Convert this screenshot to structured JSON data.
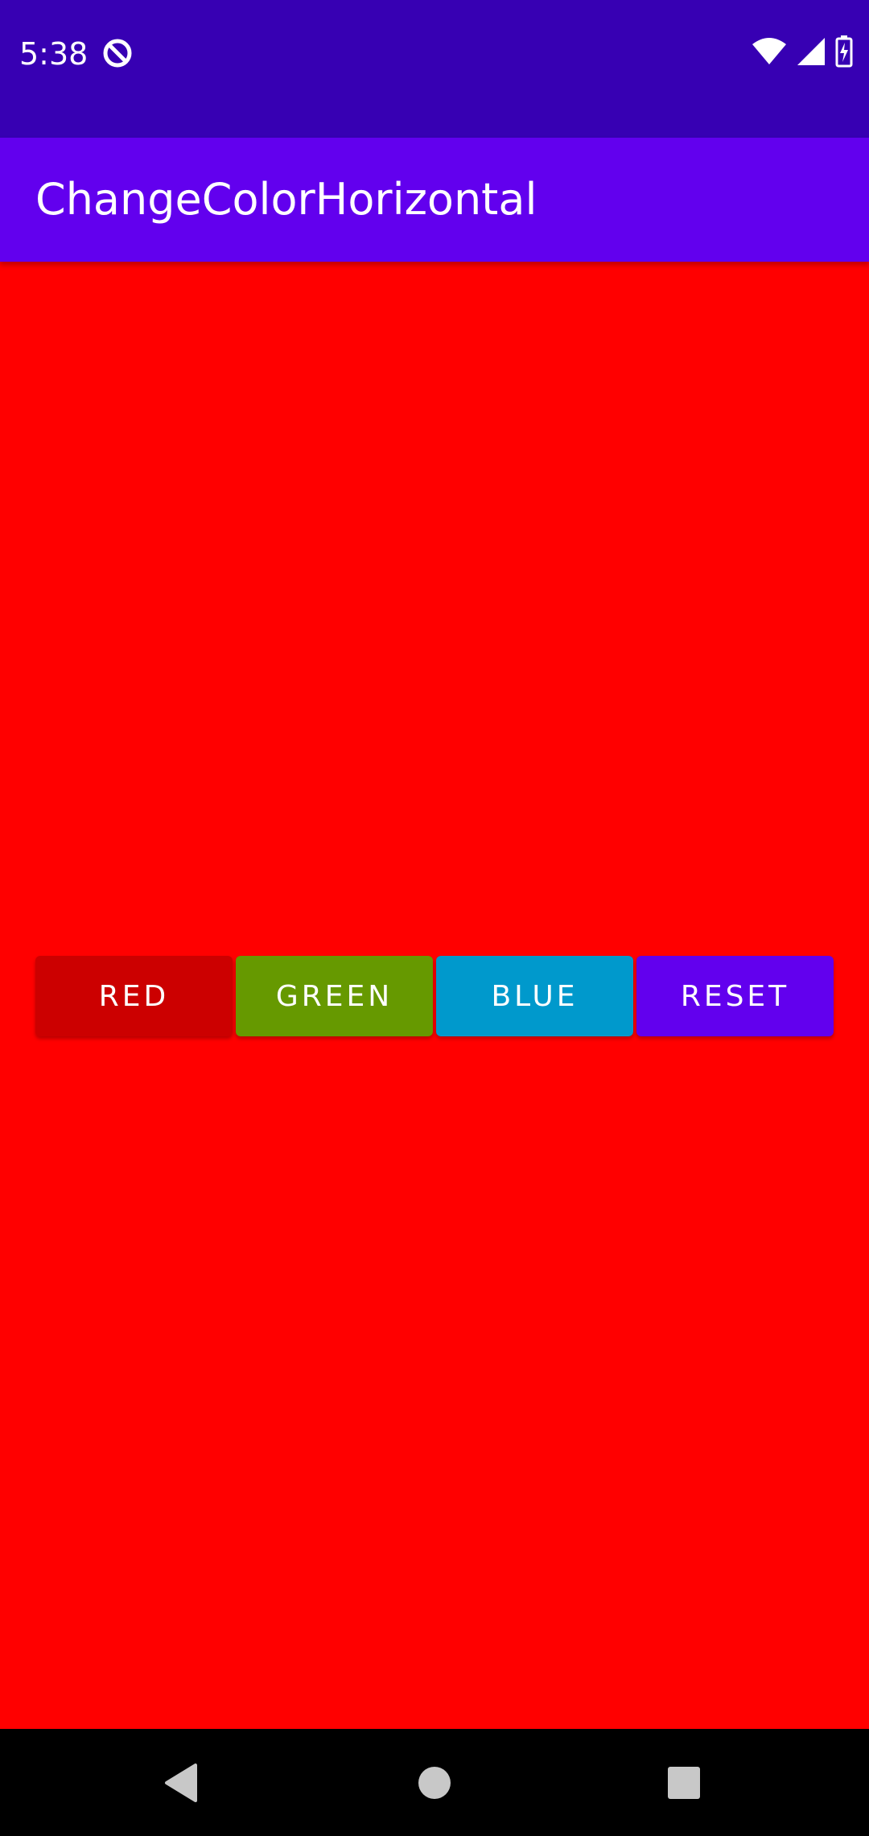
{
  "status_bar": {
    "time": "5:38",
    "app_icon": "no-disturb-icon",
    "icons": [
      "wifi-icon",
      "cell-signal-icon",
      "battery-charging-icon"
    ]
  },
  "app_bar": {
    "title": "ChangeColorHorizontal",
    "color": "#6200ee"
  },
  "content": {
    "background_color": "#ff0000"
  },
  "buttons": [
    {
      "label": "RED",
      "color": "#cc0000"
    },
    {
      "label": "GREEN",
      "color": "#669900"
    },
    {
      "label": "BLUE",
      "color": "#0099cc"
    },
    {
      "label": "RESET",
      "color": "#6200ee"
    }
  ],
  "nav_bar": {
    "icons": [
      "back-icon",
      "home-icon",
      "recents-icon"
    ]
  }
}
